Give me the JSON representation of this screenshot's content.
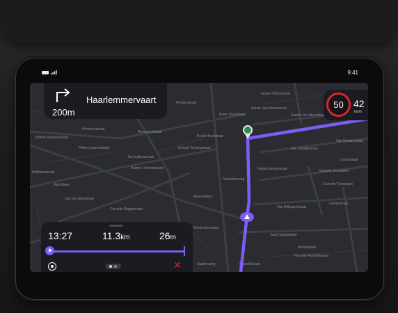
{
  "status_bar": {
    "time": "9:41"
  },
  "navigation": {
    "turn_icon": "turn-right-icon",
    "distance": "200m",
    "street": "Haarlemmervaart"
  },
  "speed": {
    "limit": "50",
    "current": "42",
    "unit": "km/h"
  },
  "trip": {
    "arrival": "13:27",
    "distance_value": "11.3",
    "distance_unit": "km",
    "time_value": "26",
    "time_unit": "m",
    "progress": 0.02
  },
  "map": {
    "labels": [
      "Govert Flinckstraat",
      "Eerste Jan Steenstraat",
      "Eerste Jan Steenstraat",
      "Royskestraat",
      "Roelof Hartstraat",
      "Pieter Baststraat",
      "Hemweestraat",
      "Rooseveltstraat",
      "Gerard Terborgstraat",
      "Willem Vroesenstraat",
      "Jan Luijkenstraat",
      "Reijner Vinkeleskade",
      "Appollaan",
      "Van Ostadestraat",
      "Van Ostadestraat",
      "Cornelis Troostplein",
      "Cornelis Troostlaan",
      "Lutmastraat",
      "Rustenburgerstraat",
      "Van Hilligaertstraat",
      "Jozef Israelskade",
      "Amstelkade",
      "Churchill-laan",
      "Minervalaan",
      "Jan van Eijckstraat",
      "Cornelis Dopperkade",
      "Beethovenstraat",
      "Marathonweg",
      "Pieter Lastmankade",
      "Hobbemakade",
      "Noorder Amstelkanaal",
      "Stadionweg",
      "Lomanstraat"
    ],
    "route_color": "#7e5df6",
    "destination_icon": "destination-pin-icon",
    "position_icon": "vehicle-position-icon"
  },
  "controls": {
    "recenter_icon": "recenter-icon",
    "pager_icon": "page-indicator-icon",
    "close_icon": "close-icon"
  }
}
